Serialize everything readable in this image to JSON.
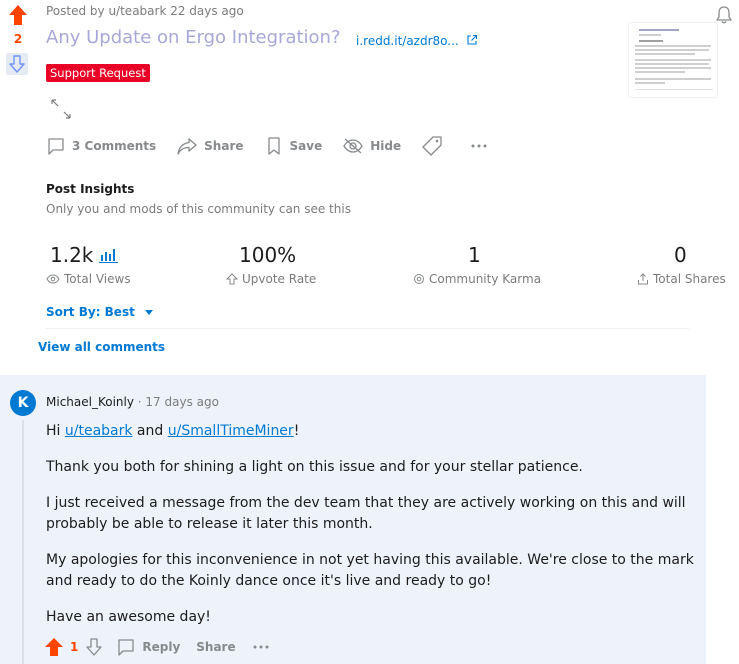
{
  "post": {
    "score": "2",
    "meta": "Posted by u/teabark 22 days ago",
    "title": "Any Update on Ergo Integration?",
    "link_text": "i.redd.it/azdr8o...",
    "flair": "Support Request",
    "actions": {
      "comments": "3 Comments",
      "share": "Share",
      "save": "Save",
      "hide": "Hide"
    }
  },
  "insights": {
    "title": "Post Insights",
    "subtitle": "Only you and mods of this community can see this",
    "stats": [
      {
        "value": "1.2k",
        "label": "Total Views",
        "icon": "eye-icon"
      },
      {
        "value": "100%",
        "label": "Upvote Rate",
        "icon": "upvote-outline-icon"
      },
      {
        "value": "1",
        "label": "Community Karma",
        "icon": "karma-icon"
      },
      {
        "value": "0",
        "label": "Total Shares",
        "icon": "share-icon"
      }
    ]
  },
  "sort": {
    "label": "Sort By: Best"
  },
  "view_all": "View all comments",
  "comment": {
    "avatar_letter": "K",
    "author": "Michael_Koinly",
    "time": "· 17 days ago",
    "greeting_prefix": "Hi ",
    "mention1": "u/teabark",
    "greeting_and": " and ",
    "mention2": "u/SmallTimeMiner",
    "greeting_suffix": "!",
    "paragraphs": [
      "Thank you both for shining a light on this issue and for your stellar patience.",
      "I just received a message from the dev team that they are actively working on this and will probably be able to release it later this month.",
      "My apologies for this inconvenience in not yet having this available. We're close to the mark and ready to do the Koinly dance once it's live and ready to go!",
      "Have an awesome day!"
    ],
    "score": "1",
    "reply": "Reply",
    "share": "Share"
  },
  "colors": {
    "upvote": "#ff4500",
    "flair_bg": "#ea0027",
    "link": "#0079d3",
    "comment_bg": "#eef3fb",
    "title_visited": "#a8a8d8"
  }
}
